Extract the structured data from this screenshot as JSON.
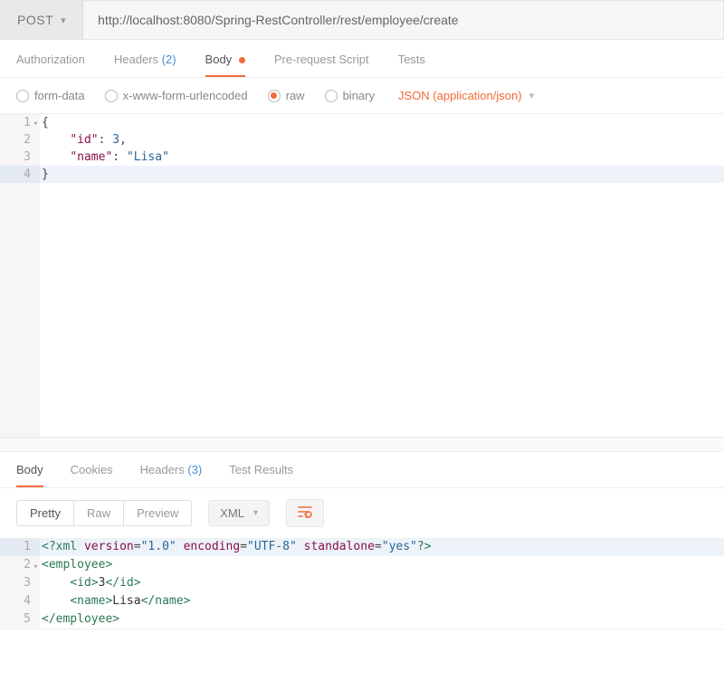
{
  "request": {
    "method": "POST",
    "url": "http://localhost:8080/Spring-RestController/rest/employee/create"
  },
  "tabs": {
    "authorization": "Authorization",
    "headers_label": "Headers",
    "headers_count": "(2)",
    "body_label": "Body",
    "prerequest": "Pre-request Script",
    "tests": "Tests"
  },
  "body_options": {
    "formdata": "form-data",
    "urlencoded": "x-www-form-urlencoded",
    "raw": "raw",
    "binary": "binary",
    "content_type": "JSON (application/json)"
  },
  "body_code": {
    "l1_n": "1",
    "l2_n": "2",
    "l3_n": "3",
    "l4_n": "4",
    "key_id": "\"id\"",
    "val_id": "3",
    "key_name": "\"name\"",
    "val_name": "\"Lisa\""
  },
  "resp_tabs": {
    "body": "Body",
    "cookies": "Cookies",
    "headers_label": "Headers",
    "headers_count": "(3)",
    "test_results": "Test Results"
  },
  "resp_controls": {
    "pretty": "Pretty",
    "raw": "Raw",
    "preview": "Preview",
    "format": "XML",
    "wrap_icon": "⟲"
  },
  "resp_code": {
    "l1_n": "1",
    "l2_n": "2",
    "l3_n": "3",
    "l4_n": "4",
    "l5_n": "5",
    "pi_open": "<?",
    "pi_name": "xml",
    "attr_version": "version",
    "val_version": "\"1.0\"",
    "attr_encoding": "encoding",
    "val_encoding": "\"UTF-8\"",
    "attr_standalone": "standalone",
    "val_standalone": "\"yes\"",
    "pi_close": "?>",
    "lt": "<",
    "lts": "</",
    "gt": ">",
    "tag_employee": "employee",
    "tag_id": "id",
    "tag_name": "name",
    "txt_id": "3",
    "txt_name": "Lisa"
  }
}
